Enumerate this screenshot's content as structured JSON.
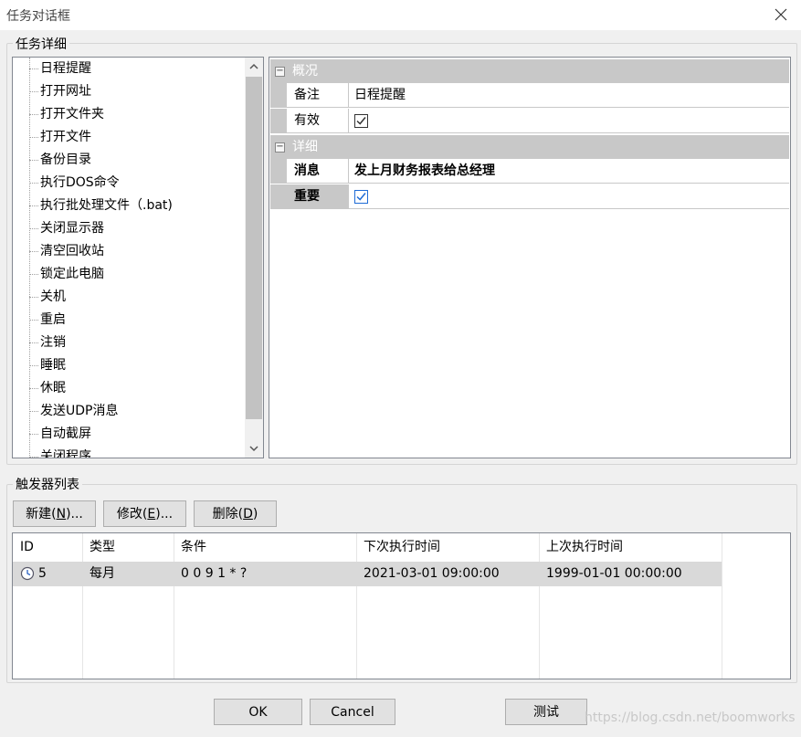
{
  "window": {
    "title": "任务对话框"
  },
  "task_details": {
    "legend": "任务详细",
    "tree_items": [
      "日程提醒",
      "打开网址",
      "打开文件夹",
      "打开文件",
      "备份目录",
      "执行DOS命令",
      "执行批处理文件（.bat)",
      "关闭显示器",
      "清空回收站",
      "锁定此电脑",
      "关机",
      "重启",
      "注销",
      "睡眠",
      "休眠",
      "发送UDP消息",
      "自动截屏",
      "关闭程序"
    ],
    "selected_index": 0
  },
  "property_grid": {
    "categories": [
      {
        "label": "概况",
        "rows": [
          {
            "name": "备注",
            "value": "日程提醒",
            "type": "text"
          },
          {
            "name": "有效",
            "value": "",
            "type": "checkbox",
            "checked": true
          }
        ]
      },
      {
        "label": "详细",
        "rows": [
          {
            "name": "消息",
            "value": "发上月财务报表给总经理",
            "type": "text",
            "bold": true
          },
          {
            "name": "重要",
            "value": "",
            "type": "checkbox",
            "checked": true,
            "bold": true,
            "selected": true
          }
        ]
      }
    ]
  },
  "triggers": {
    "legend": "触发器列表",
    "buttons": {
      "new_prefix": "新建(",
      "new_key": "N",
      "new_suffix": ")...",
      "edit_prefix": "修改(",
      "edit_key": "E",
      "edit_suffix": ")...",
      "delete_prefix": "删除(",
      "delete_key": "D",
      "delete_suffix": ")"
    },
    "columns": [
      "ID",
      "类型",
      "条件",
      "下次执行时间",
      "上次执行时间"
    ],
    "rows": [
      {
        "id": "5",
        "type": "每月",
        "condition": "0 0 9 1 * ?",
        "next": "2021-03-01 09:00:00",
        "last": "1999-01-01 00:00:00"
      }
    ]
  },
  "footer": {
    "ok": "OK",
    "cancel": "Cancel",
    "test": "测试"
  },
  "watermark": "https://blog.csdn.net/boomworks",
  "colors": {
    "selection_gray": "#c8c8c8",
    "checkbox_blue": "#1e6bd6",
    "row_selected": "#d9d9d9"
  }
}
